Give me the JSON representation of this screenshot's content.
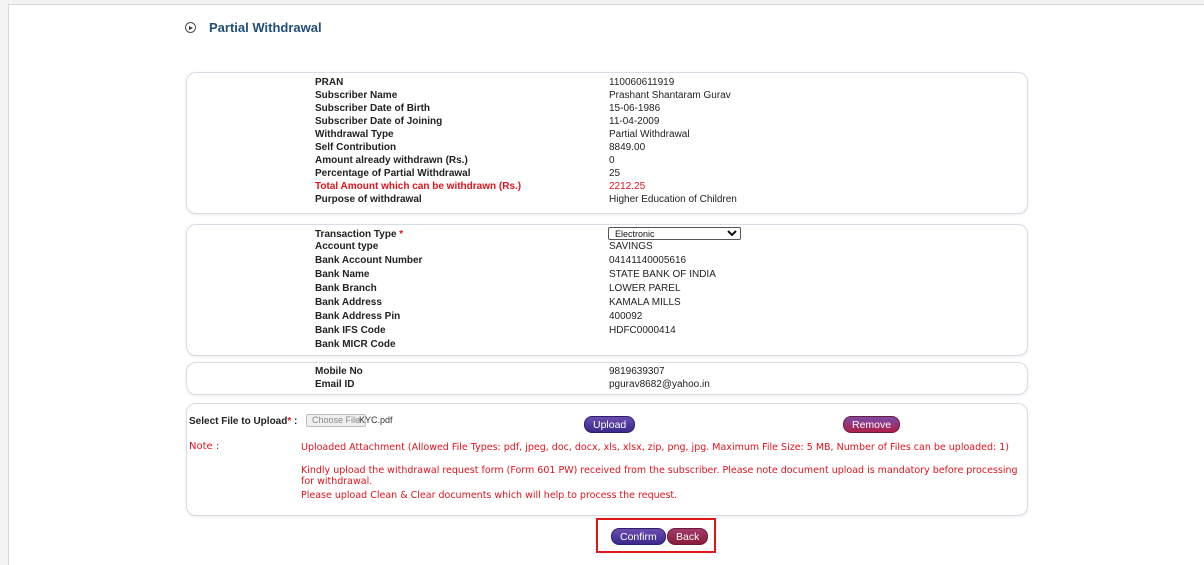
{
  "header": {
    "title": "Partial Withdrawal",
    "icon": "circle-arrow-icon"
  },
  "subscriber": {
    "rows": [
      {
        "label": "PRAN",
        "value": "110060611919"
      },
      {
        "label": "Subscriber Name",
        "value": "Prashant Shantaram Gurav"
      },
      {
        "label": "Subscriber Date of Birth",
        "value": "15-06-1986"
      },
      {
        "label": "Subscriber Date of Joining",
        "value": "11-04-2009"
      },
      {
        "label": "Withdrawal Type",
        "value": "Partial Withdrawal"
      },
      {
        "label": "Self Contribution",
        "value": "8849.00"
      },
      {
        "label": "Amount already withdrawn (Rs.)",
        "value": "0"
      },
      {
        "label": "Percentage of Partial Withdrawal",
        "value": "25"
      },
      {
        "label": "Total Amount which can be withdrawn (Rs.)",
        "value": "2212.25"
      },
      {
        "label": "Purpose of withdrawal",
        "value": "Higher Education of Children"
      }
    ]
  },
  "bank": {
    "transaction_label": "Transaction Type",
    "required_mark": "*",
    "transaction_value": "Electronic",
    "rows": [
      {
        "label": "Account type",
        "value": "SAVINGS"
      },
      {
        "label": "Bank Account Number",
        "value": "04141140005616"
      },
      {
        "label": "Bank Name",
        "value": "STATE BANK OF INDIA"
      },
      {
        "label": "Bank Branch",
        "value": "LOWER PAREL"
      },
      {
        "label": "Bank Address",
        "value": "KAMALA MILLS"
      },
      {
        "label": "Bank Address Pin",
        "value": "400092"
      },
      {
        "label": "Bank IFS Code",
        "value": "HDFC0000414"
      },
      {
        "label": "Bank MICR Code",
        "value": ""
      }
    ]
  },
  "contact": {
    "rows": [
      {
        "label": "Mobile No",
        "value": "9819639307"
      },
      {
        "label": "Email ID",
        "value": "pgurav8682@yahoo.in"
      }
    ]
  },
  "upload": {
    "label": "Select File to Upload",
    "required_mark": "*",
    "colon": " :",
    "choose_label": "Choose File",
    "file_name": "KYC.pdf",
    "upload_label": "Upload",
    "remove_label": "Remove",
    "note_label": "Note :",
    "notes": [
      "Uploaded Attachment (Allowed File Types: pdf, jpeg, doc, docx, xls, xlsx, zip, png, jpg. Maximum File Size: 5 MB, Number of Files can be uploaded: 1)",
      "Kindly upload the withdrawal request form (Form 601 PW) received from the subscriber. Please note document upload is mandatory before processing for withdrawal.",
      "Please upload Clean & Clear documents which will help to process the request."
    ]
  },
  "actions": {
    "confirm_label": "Confirm",
    "back_label": "Back"
  },
  "colors": {
    "title": "#1f4e79",
    "warning_red": "#e0141e",
    "button_purple": "#3b2a8a",
    "highlight_box": "#e01818"
  }
}
